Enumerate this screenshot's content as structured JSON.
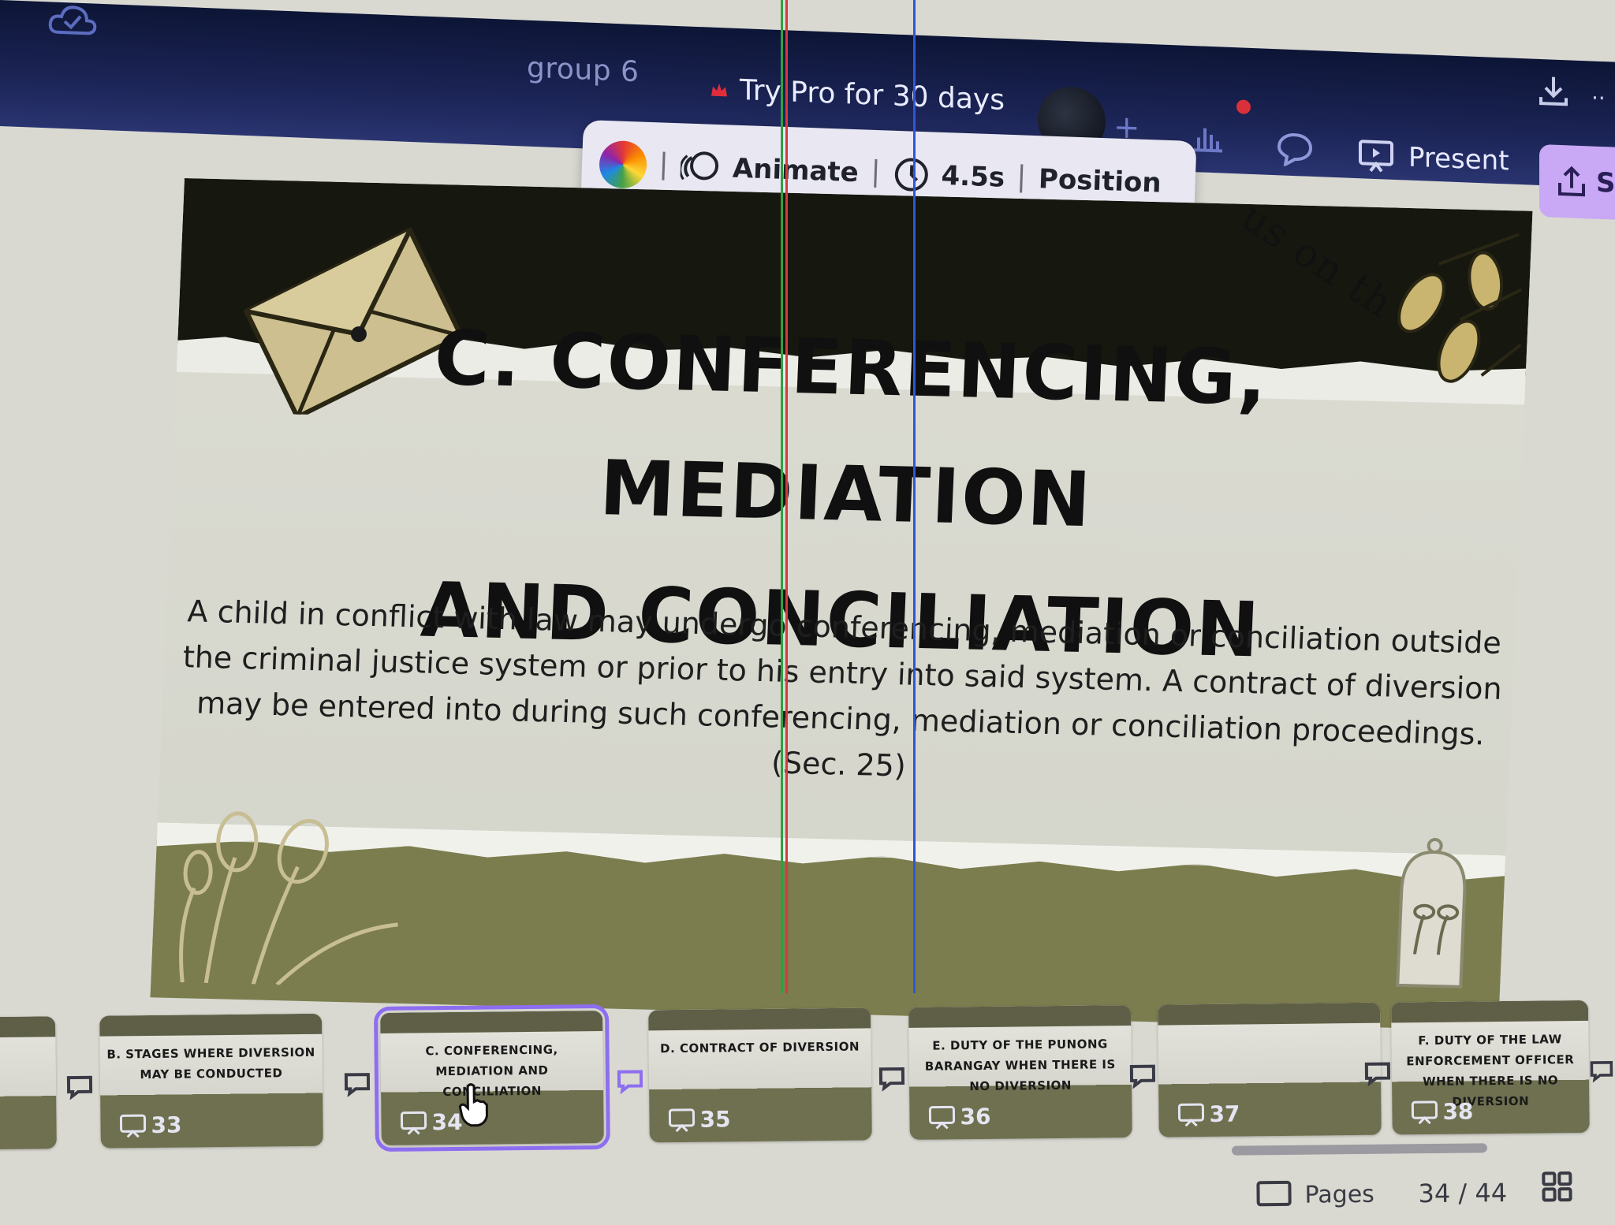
{
  "header": {
    "project_name": "group 6",
    "promo_label": "Try Pro for 30 days",
    "present_label": "Present",
    "share_label": "S"
  },
  "toolbar": {
    "animate_label": "Animate",
    "duration_label": "4.5s",
    "position_label": "Position"
  },
  "slide": {
    "title_line1": "C. CONFERENCING, MEDIATION",
    "title_line2": "AND CONCILIATION",
    "body": "A child in conflict with law may undergo conferencing, mediation or conciliation outside the criminal justice system or prior to his entry into said system. A contract of diversion may be entered into during such conferencing, mediation or conciliation proceedings.",
    "citation": "(Sec. 25)",
    "script_text": "us on th"
  },
  "pages": {
    "thumbnails": [
      {
        "label": "B. STAGES WHERE DIVERSION MAY BE CONDUCTED",
        "number": "33"
      },
      {
        "label": "C. CONFERENCING, MEDIATION AND CONCILIATION",
        "number": "34"
      },
      {
        "label": "D. CONTRACT OF DIVERSION",
        "number": "35"
      },
      {
        "label": "E. DUTY OF THE PUNONG BARANGAY WHEN THERE IS NO DIVERSION",
        "number": "36"
      },
      {
        "label": "",
        "number": "37"
      },
      {
        "label": "F. DUTY OF THE LAW ENFORCEMENT OFFICER WHEN THERE IS NO DIVERSION",
        "number": "38"
      }
    ],
    "pages_label": "Pages",
    "page_count": "34 / 44"
  },
  "colors": {
    "topbar": "#1b2455",
    "share_button": "#c9a8f5",
    "selected_outline": "#8d6ef0",
    "slide_dark": "#16170f",
    "slide_olive": "#7c7d4e"
  }
}
